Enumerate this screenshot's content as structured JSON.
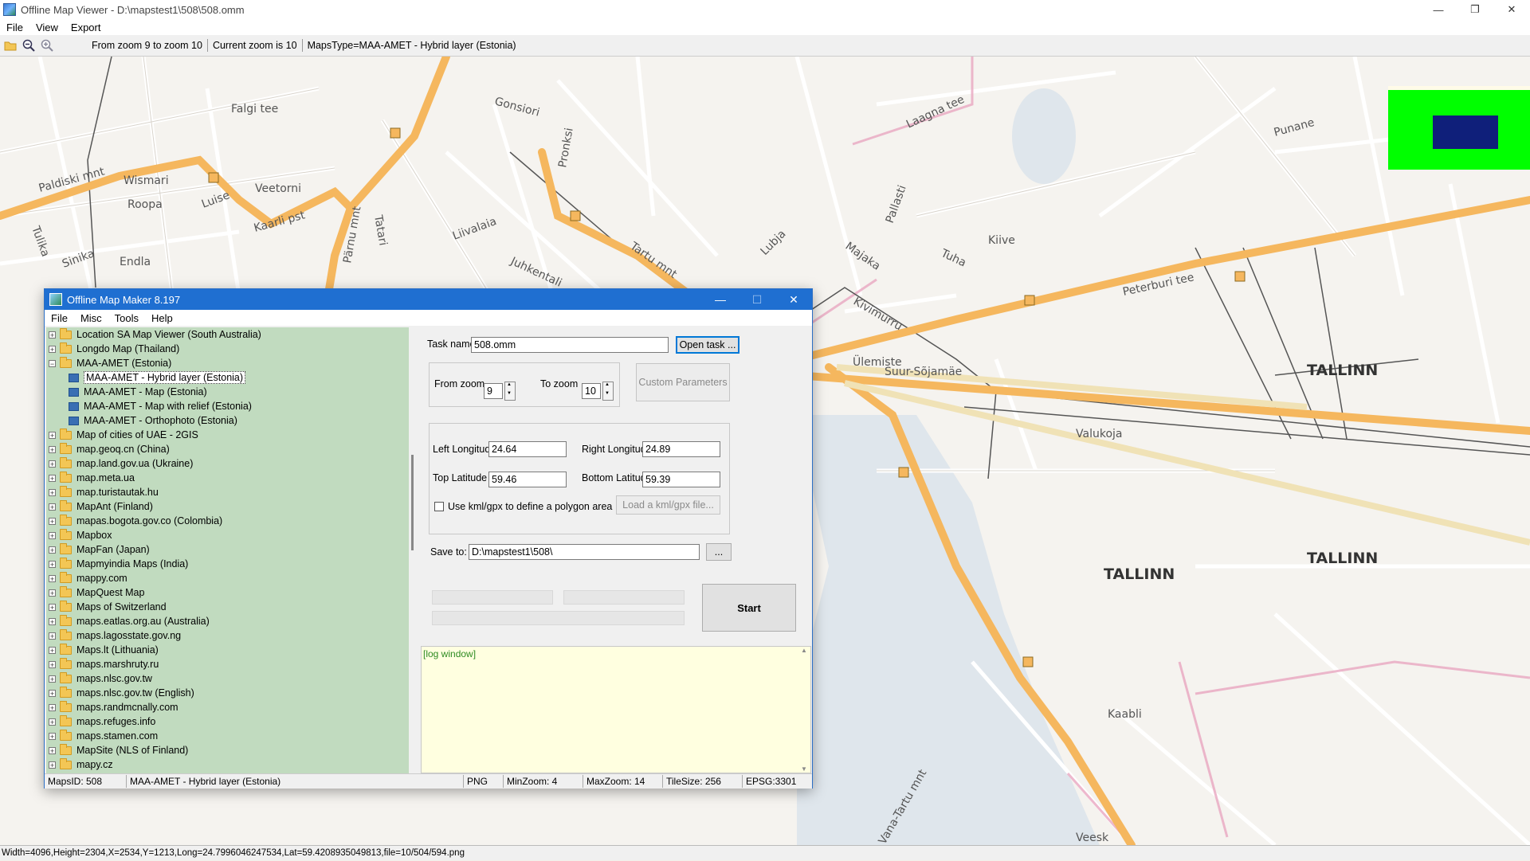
{
  "window": {
    "title": "Offline Map Viewer - D:\\mapstest1\\508\\508.omm",
    "controls": [
      "—",
      "❐",
      "✕"
    ]
  },
  "menubar": [
    "File",
    "View",
    "Export"
  ],
  "toolbar": {
    "info": [
      "From zoom 9 to zoom 10",
      "Current zoom is 10",
      "MapsType=MAA-AMET - Hybrid layer (Estonia)"
    ]
  },
  "map": {
    "labels": [
      {
        "text": "Paldiski mnt"
      },
      {
        "text": "Kaarli pst"
      },
      {
        "text": "Falgi tee"
      },
      {
        "text": "Wismari"
      },
      {
        "text": "Roopa"
      },
      {
        "text": "Luise"
      },
      {
        "text": "Endla"
      },
      {
        "text": "Veetorni"
      },
      {
        "text": "Tulika"
      },
      {
        "text": "Sinika"
      },
      {
        "text": "Pärnu mnt"
      },
      {
        "text": "Tatari"
      },
      {
        "text": "Liivalaia"
      },
      {
        "text": "Juhkentali"
      },
      {
        "text": "Gonsiori"
      },
      {
        "text": "Pronksi"
      },
      {
        "text": "Tartu mnt"
      },
      {
        "text": "Lubja"
      },
      {
        "text": "Majaka"
      },
      {
        "text": "Laagna tee"
      },
      {
        "text": "Punane"
      },
      {
        "text": "Peterburi tee"
      },
      {
        "text": "Suur-Sõjamäe"
      },
      {
        "text": "Valukoja"
      },
      {
        "text": "Ülemiste"
      },
      {
        "text": "TALLINN"
      },
      {
        "text": "Kivimurru"
      },
      {
        "text": "Pallasti"
      },
      {
        "text": "Tuha"
      },
      {
        "text": "Kiive"
      },
      {
        "text": "Vana-Tartu mnt"
      },
      {
        "text": "Kaabli"
      },
      {
        "text": "Veesk"
      }
    ],
    "legend_colors": {
      "outer": "#00ff00",
      "inner": "#0f1f7a"
    }
  },
  "bottom_status": "Width=4096,Height=2304,X=2534,Y=1213,Long=24.7996046247534,Lat=59.4208935049813,file=10/504/594.png",
  "dialog": {
    "title": "Offline Map Maker 8.197",
    "controls": [
      "—",
      "☐",
      "✕"
    ],
    "menu": [
      "File",
      "Misc",
      "Tools",
      "Help"
    ],
    "tree": [
      {
        "label": "Location SA Map Viewer (South Australia)",
        "type": "folder"
      },
      {
        "label": "Longdo Map (Thailand)",
        "type": "folder"
      },
      {
        "label": "MAA-AMET (Estonia)",
        "type": "folder-open"
      },
      {
        "label": "MAA-AMET - Hybrid layer (Estonia)",
        "type": "map",
        "selected": true
      },
      {
        "label": "MAA-AMET - Map (Estonia)",
        "type": "map"
      },
      {
        "label": "MAA-AMET - Map with relief (Estonia)",
        "type": "map"
      },
      {
        "label": "MAA-AMET - Orthophoto (Estonia)",
        "type": "map"
      },
      {
        "label": "Map of cities of UAE - 2GIS",
        "type": "folder"
      },
      {
        "label": "map.geoq.cn (China)",
        "type": "folder"
      },
      {
        "label": "map.land.gov.ua (Ukraine)",
        "type": "folder"
      },
      {
        "label": "map.meta.ua",
        "type": "folder"
      },
      {
        "label": "map.turistautak.hu",
        "type": "folder"
      },
      {
        "label": "MapAnt (Finland)",
        "type": "folder"
      },
      {
        "label": "mapas.bogota.gov.co (Colombia)",
        "type": "folder"
      },
      {
        "label": "Mapbox",
        "type": "folder"
      },
      {
        "label": "MapFan (Japan)",
        "type": "folder"
      },
      {
        "label": "Mapmyindia Maps (India)",
        "type": "folder"
      },
      {
        "label": "mappy.com",
        "type": "folder"
      },
      {
        "label": "MapQuest Map",
        "type": "folder"
      },
      {
        "label": "Maps of Switzerland",
        "type": "folder"
      },
      {
        "label": "maps.eatlas.org.au (Australia)",
        "type": "folder"
      },
      {
        "label": "maps.lagosstate.gov.ng",
        "type": "folder"
      },
      {
        "label": "Maps.lt (Lithuania)",
        "type": "folder"
      },
      {
        "label": "maps.marshruty.ru",
        "type": "folder"
      },
      {
        "label": "maps.nlsc.gov.tw",
        "type": "folder"
      },
      {
        "label": "maps.nlsc.gov.tw (English)",
        "type": "folder"
      },
      {
        "label": "maps.randmcnally.com",
        "type": "folder"
      },
      {
        "label": "maps.refuges.info",
        "type": "folder"
      },
      {
        "label": "maps.stamen.com",
        "type": "folder"
      },
      {
        "label": "MapSite (NLS of Finland)",
        "type": "folder"
      },
      {
        "label": "mapy.cz",
        "type": "folder"
      }
    ],
    "form": {
      "task_name_label": "Task name",
      "task_name_value": "508.omm",
      "open_task_btn": "Open task ...",
      "from_zoom_label": "From zoom",
      "from_zoom_value": "9",
      "to_zoom_label": "To zoom",
      "to_zoom_value": "10",
      "custom_params_btn": "Custom Parameters",
      "left_lon_label": "Left Longitude",
      "left_lon_value": "24.64",
      "right_lon_label": "Right Longitude",
      "right_lon_value": "24.89",
      "top_lat_label": "Top Latitude",
      "top_lat_value": "59.46",
      "bottom_lat_label": "Bottom Latitude",
      "bottom_lat_value": "59.39",
      "kml_label": "Use kml/gpx to define a polygon area",
      "load_kml_btn": "Load a kml/gpx file...",
      "save_to_label": "Save to:",
      "save_to_value": "D:\\mapstest1\\508\\",
      "browse_btn": "...",
      "start_btn": "Start"
    },
    "log": "[log window]",
    "status": [
      "MapsID: 508",
      "MAA-AMET - Hybrid layer (Estonia)",
      "PNG",
      "MinZoom: 4",
      "MaxZoom: 14",
      "TileSize: 256",
      "EPSG:3301"
    ]
  }
}
